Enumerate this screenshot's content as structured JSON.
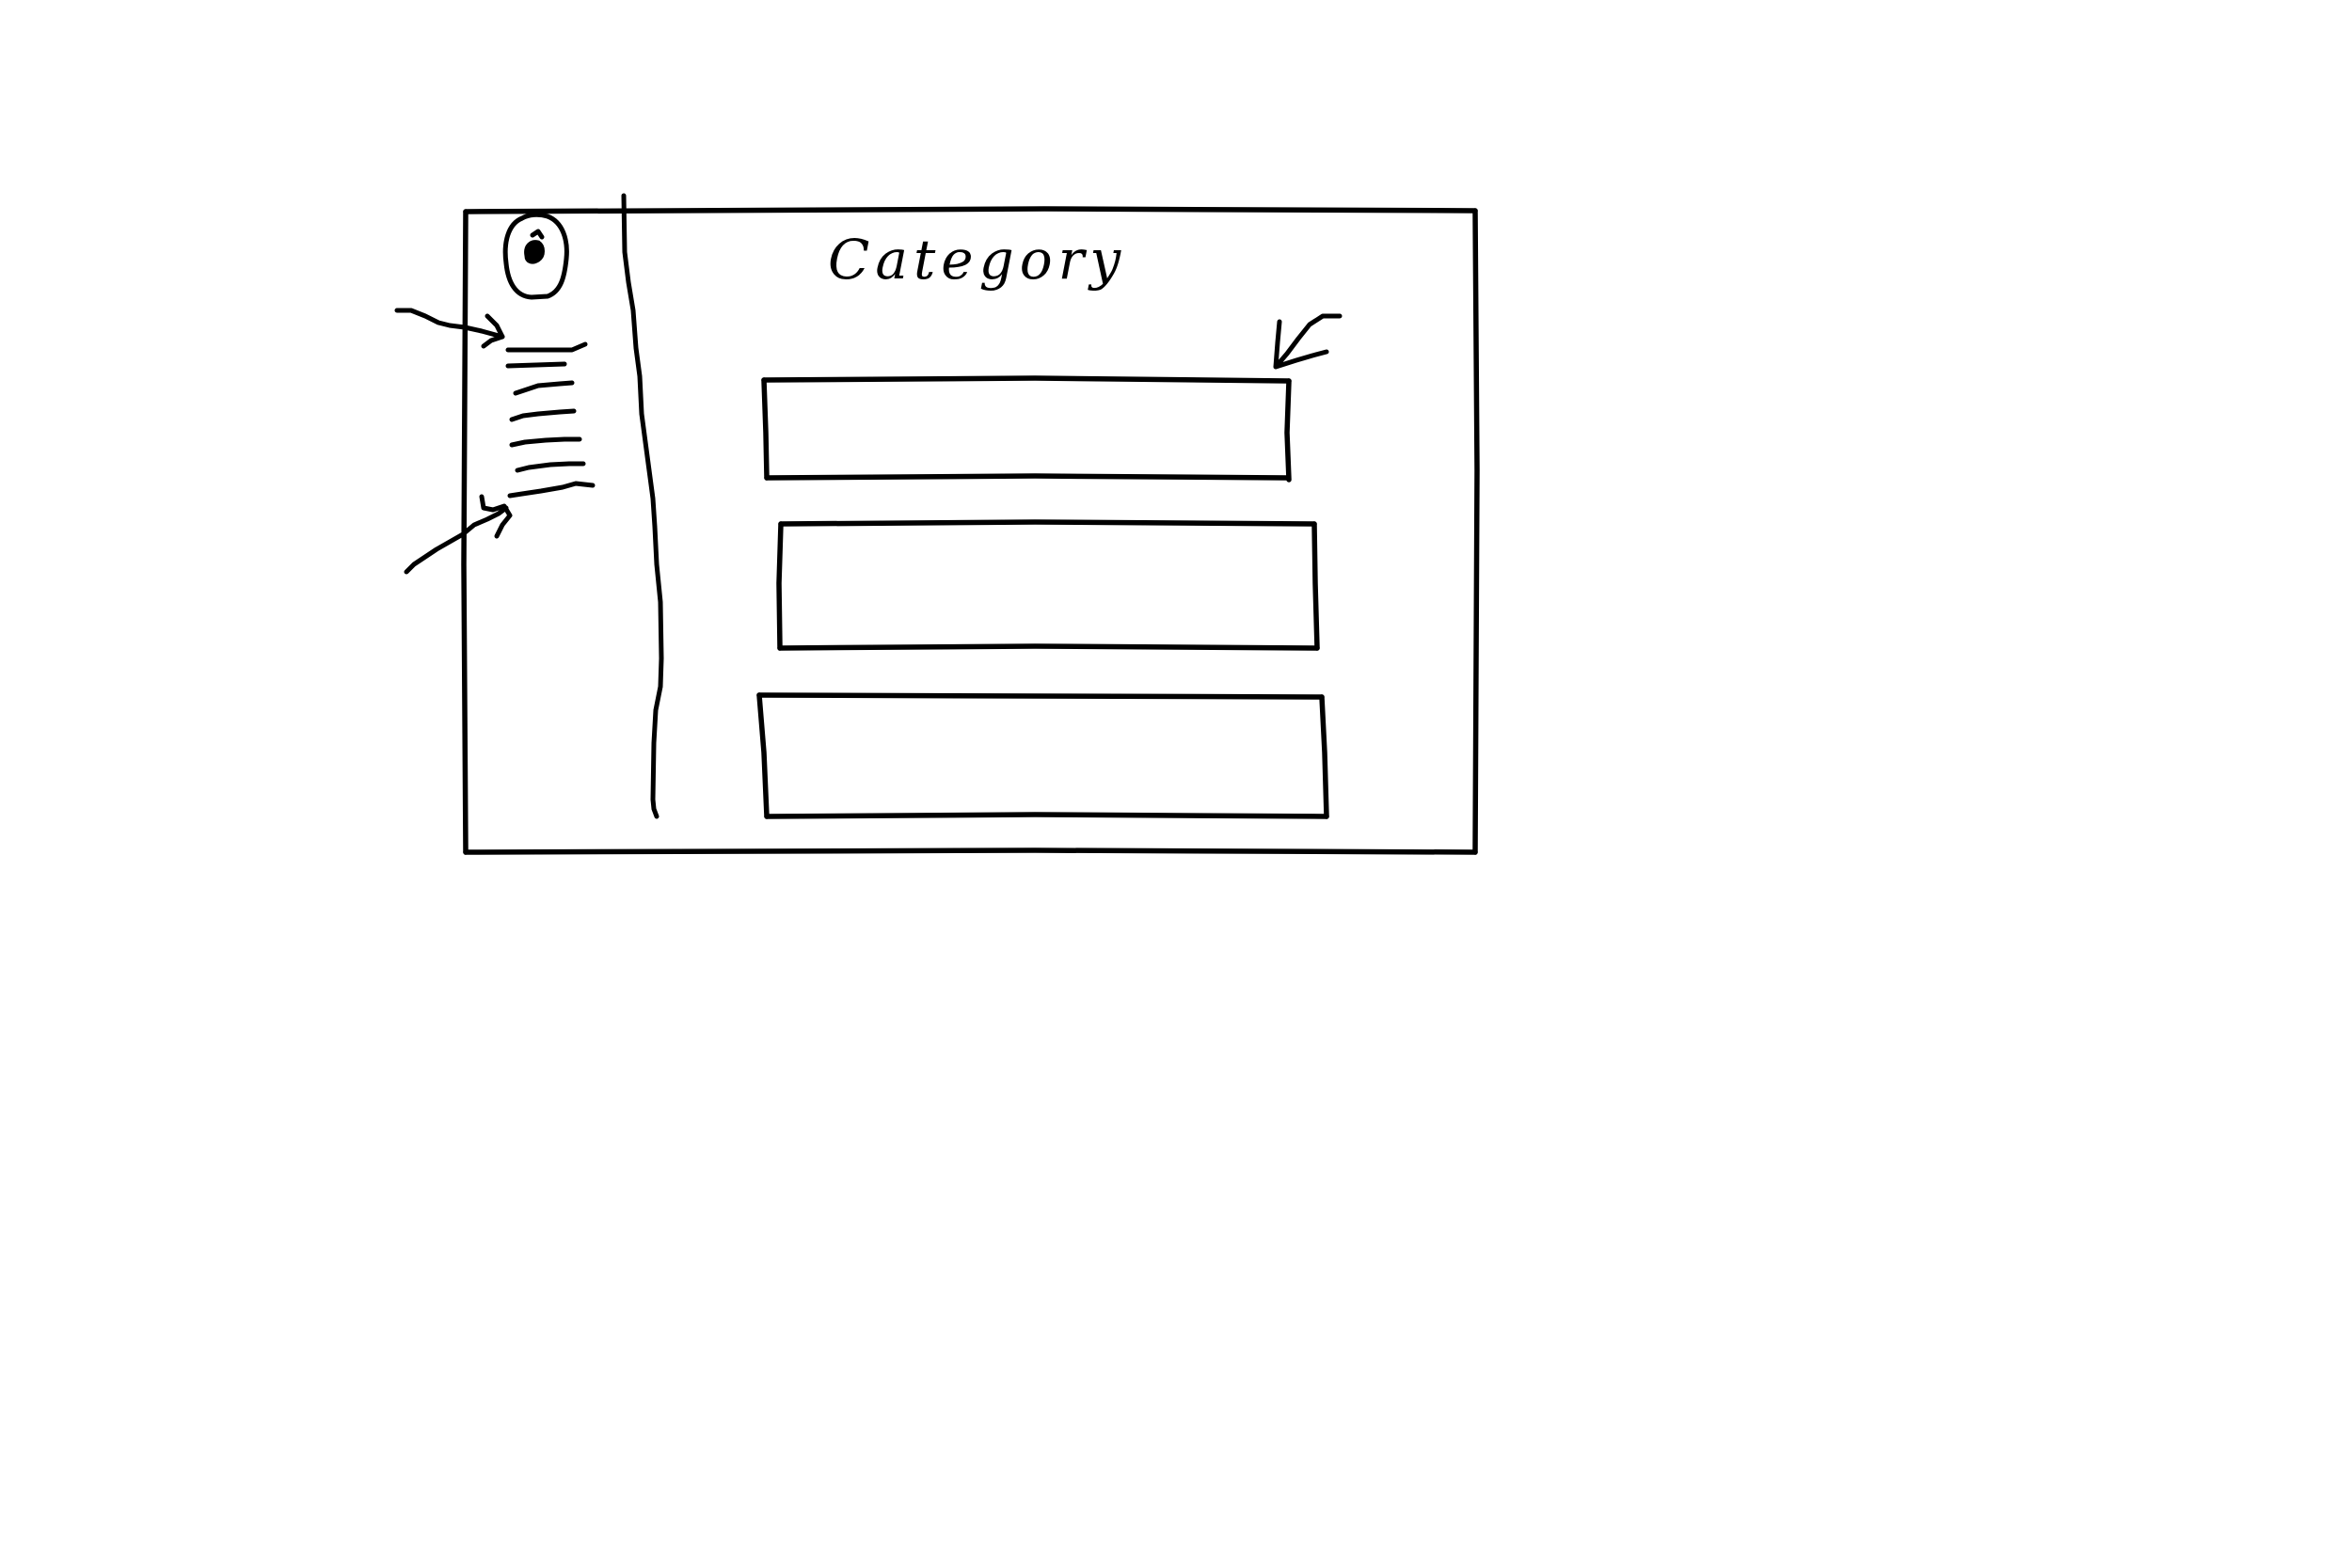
{
  "wireframe": {
    "title": "Category",
    "sidebar": {
      "logo_icon": "app-logo-icon",
      "menu_icon": "hamburger-menu-icon",
      "menu_lines": 7
    },
    "main": {
      "category_items": [
        {
          "selected": true
        },
        {
          "selected": false
        },
        {
          "selected": false
        }
      ],
      "check_icon": "checkmark-icon"
    },
    "annotations": [
      "arrow-icon",
      "arrow-icon"
    ]
  }
}
